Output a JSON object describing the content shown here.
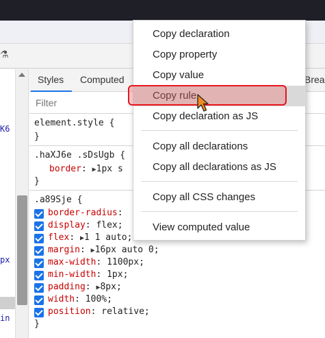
{
  "tabs": {
    "styles": "Styles",
    "computed": "Computed",
    "partial": "Brea"
  },
  "filter": {
    "placeholder": "Filter"
  },
  "left_fragments": [
    "K6",
    "px",
    "in"
  ],
  "rules": [
    {
      "selector": "element.style {",
      "close": "}"
    },
    {
      "selector": ".haXJ6e .sDsUgb {",
      "decls": [
        {
          "prop": "border",
          "val": "1px s"
        }
      ],
      "close": "}"
    },
    {
      "selector": ".a89Sje {",
      "decls": [
        {
          "prop": "border-radius",
          "val": ""
        },
        {
          "prop": "display",
          "val": "flex;"
        },
        {
          "prop": "flex",
          "val": "1 1 auto;"
        },
        {
          "prop": "margin",
          "val": "16px auto 0;"
        },
        {
          "prop": "max-width",
          "val": "1100px;"
        },
        {
          "prop": "min-width",
          "val": "1px;"
        },
        {
          "prop": "padding",
          "val": "8px;"
        },
        {
          "prop": "width",
          "val": "100%;"
        },
        {
          "prop": "position",
          "val": "relative;"
        }
      ],
      "close": "}"
    }
  ],
  "menu": {
    "group1": [
      "Copy declaration",
      "Copy property",
      "Copy value",
      "Copy rule",
      "Copy declaration as JS"
    ],
    "group2": [
      "Copy all declarations",
      "Copy all declarations as JS"
    ],
    "group3": [
      "Copy all CSS changes"
    ],
    "group4": [
      "View computed value"
    ]
  },
  "colors": {
    "accent": "#1a73e8",
    "highlight": "#e8141c",
    "property": "#c80000"
  }
}
